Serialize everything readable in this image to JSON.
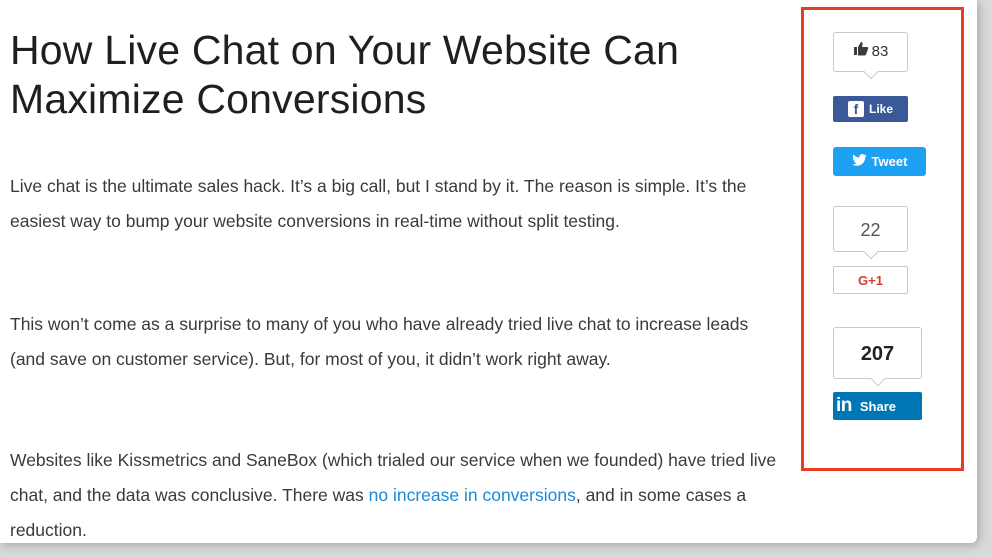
{
  "article": {
    "title": "How Live Chat on Your Website Can Maximize Conversions",
    "paragraph1": "Live chat is the ultimate sales hack. It’s a big call, but I stand by it. The reason is simple. It’s the easiest way to bump your website conversions in real-time without split testing.",
    "paragraph2": "This won’t come as a surprise to many of you who have already tried live chat to increase leads (and save on customer service). But, for most of you, it didn’t work right away.",
    "paragraph3_before": "Websites like Kissmetrics and SaneBox (which trialed our service when we founded) have tried live chat, and the data was conclusive. There was ",
    "paragraph3_link": "no increase in conversions",
    "paragraph3_after": ", and in some cases a reduction."
  },
  "share": {
    "facebook": {
      "count": "83",
      "label": "Like",
      "icon": "f"
    },
    "twitter": {
      "label": "Tweet"
    },
    "googleplus": {
      "count": "22",
      "label": "G+1"
    },
    "linkedin": {
      "count": "207",
      "label": "Share",
      "icon": "in"
    }
  },
  "colors": {
    "highlight_border": "#ea3b24",
    "facebook": "#3b5998",
    "twitter": "#1da1f2",
    "googleplus": "#d23f31",
    "linkedin": "#0077b5",
    "link": "#1a8ad6"
  }
}
